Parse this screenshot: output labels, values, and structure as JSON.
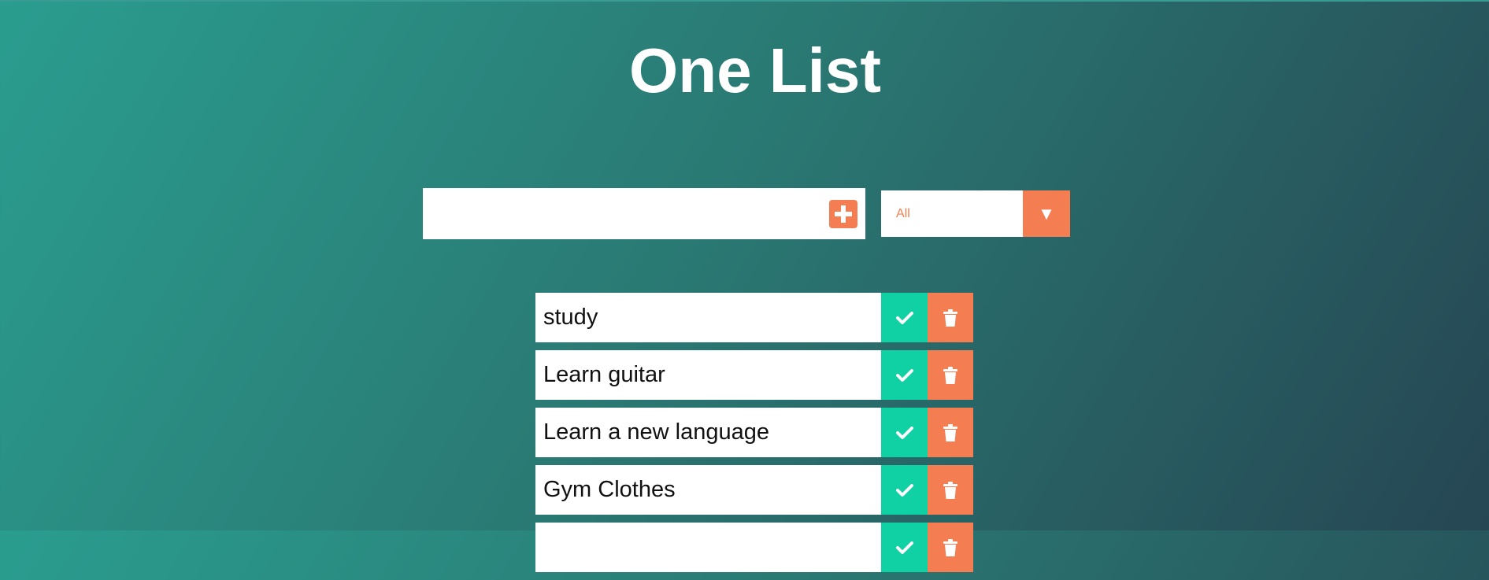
{
  "app": {
    "title": "One List"
  },
  "add_form": {
    "input_value": "",
    "placeholder": "",
    "add_button_icon": "plus-square-icon"
  },
  "filter": {
    "selected": "All",
    "arrow_icon": "caret-down-icon",
    "arrow_glyph": "▼"
  },
  "todos": [
    {
      "text": "study",
      "complete_icon": "check-icon",
      "delete_icon": "trash-icon"
    },
    {
      "text": "Learn guitar",
      "complete_icon": "check-icon",
      "delete_icon": "trash-icon"
    },
    {
      "text": "Learn a new language",
      "complete_icon": "check-icon",
      "delete_icon": "trash-icon"
    },
    {
      "text": "Gym Clothes",
      "complete_icon": "check-icon",
      "delete_icon": "trash-icon"
    },
    {
      "text": "",
      "complete_icon": "check-icon",
      "delete_icon": "trash-icon"
    }
  ],
  "colors": {
    "accent_orange": "#f47e52",
    "accent_green": "#0fd1a3",
    "gradient_start": "#2a9d8f",
    "gradient_end": "#264653",
    "text_dark": "#111111",
    "white": "#ffffff"
  }
}
